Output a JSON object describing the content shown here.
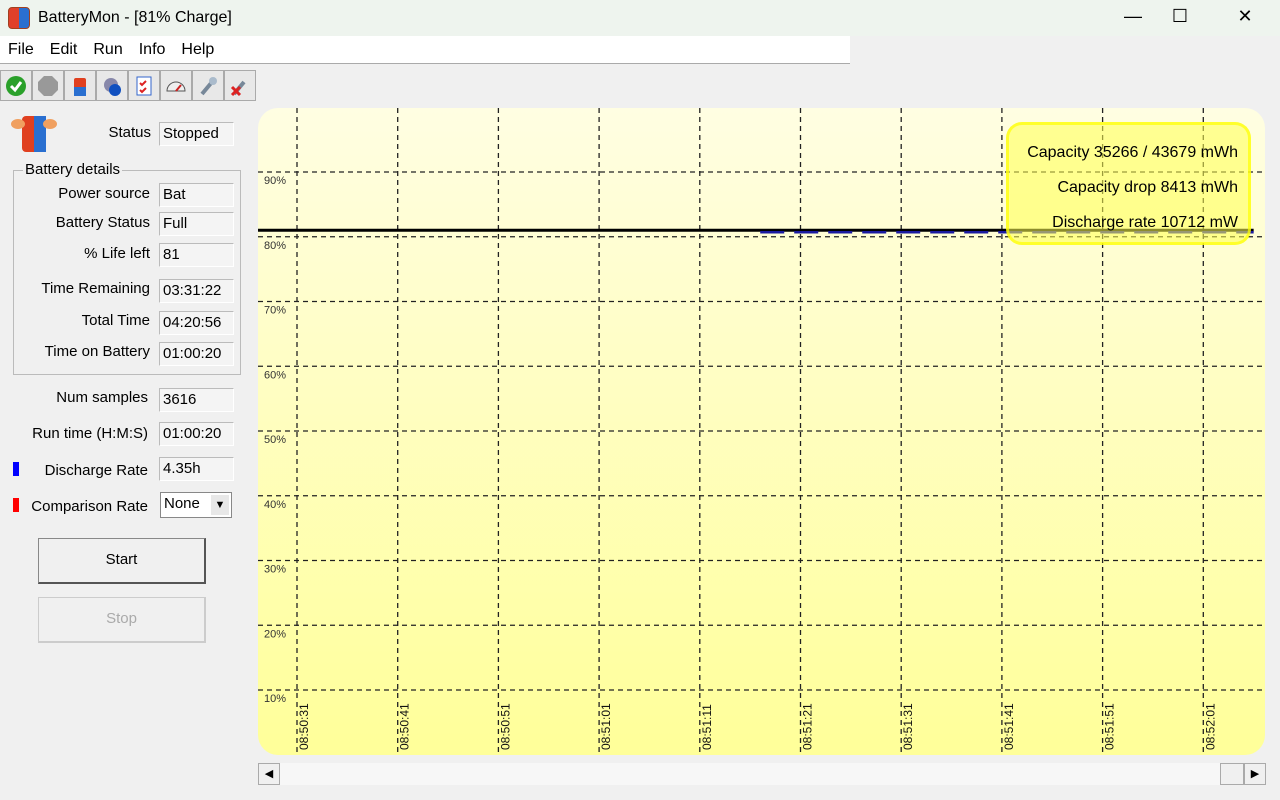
{
  "window": {
    "title": "BatteryMon - [81% Charge]",
    "minimize": "—",
    "maximize": "☐",
    "close": "✕"
  },
  "menu": [
    "File",
    "Edit",
    "Run",
    "Info",
    "Help"
  ],
  "toolbar": [
    "start-icon",
    "stop-icon",
    "battery-icon",
    "settings-icon",
    "checklist-icon",
    "gauge-icon",
    "tools-icon",
    "remove-tools-icon"
  ],
  "status": {
    "label": "Status",
    "value": "Stopped"
  },
  "battery_details": {
    "title": "Battery details",
    "rows": [
      {
        "label": "Power source",
        "value": "Bat"
      },
      {
        "label": "Battery Status",
        "value": "Full"
      },
      {
        "label": "% Life left",
        "value": "81"
      },
      {
        "label": "Time Remaining",
        "value": "03:31:22"
      },
      {
        "label": "Total Time",
        "value": "04:20:56"
      },
      {
        "label": "Time on Battery",
        "value": "01:00:20"
      }
    ]
  },
  "num_samples": {
    "label": "Num samples",
    "value": "3616"
  },
  "run_time": {
    "label": "Run time (H:M:S)",
    "value": "01:00:20"
  },
  "discharge_rate": {
    "label": "Discharge Rate",
    "value": "4.35h",
    "color": "#0000ff"
  },
  "comparison_rate": {
    "label": "Comparison Rate",
    "value": "None",
    "color": "#ff0000"
  },
  "buttons": {
    "start": "Start",
    "stop": "Stop"
  },
  "legend": [
    "Capacity 35266 / 43679 mWh",
    "Capacity drop 8413 mWh",
    "Discharge rate 10712 mW"
  ],
  "chart_data": {
    "type": "line",
    "y_ticks": [
      "90%",
      "80%",
      "70%",
      "60%",
      "50%",
      "40%",
      "30%",
      "20%",
      "10%"
    ],
    "y_values": [
      90,
      80,
      70,
      60,
      50,
      40,
      30,
      20,
      10
    ],
    "x_ticks": [
      "08:50:31",
      "08:50:41",
      "08:50:51",
      "08:51:01",
      "08:51:11",
      "08:51:21",
      "08:51:31",
      "08:51:41",
      "08:51:51",
      "08:52:01"
    ],
    "grid": true,
    "series": [
      {
        "style": "solid",
        "color": "#000000",
        "points": [
          [
            "08:50:27",
            81
          ],
          [
            "08:52:06",
            81
          ]
        ]
      },
      {
        "style": "dashed",
        "color": "#1a1aa0",
        "points": [
          [
            "08:51:17",
            80.7
          ],
          [
            "08:52:06",
            80.7
          ]
        ]
      }
    ]
  }
}
